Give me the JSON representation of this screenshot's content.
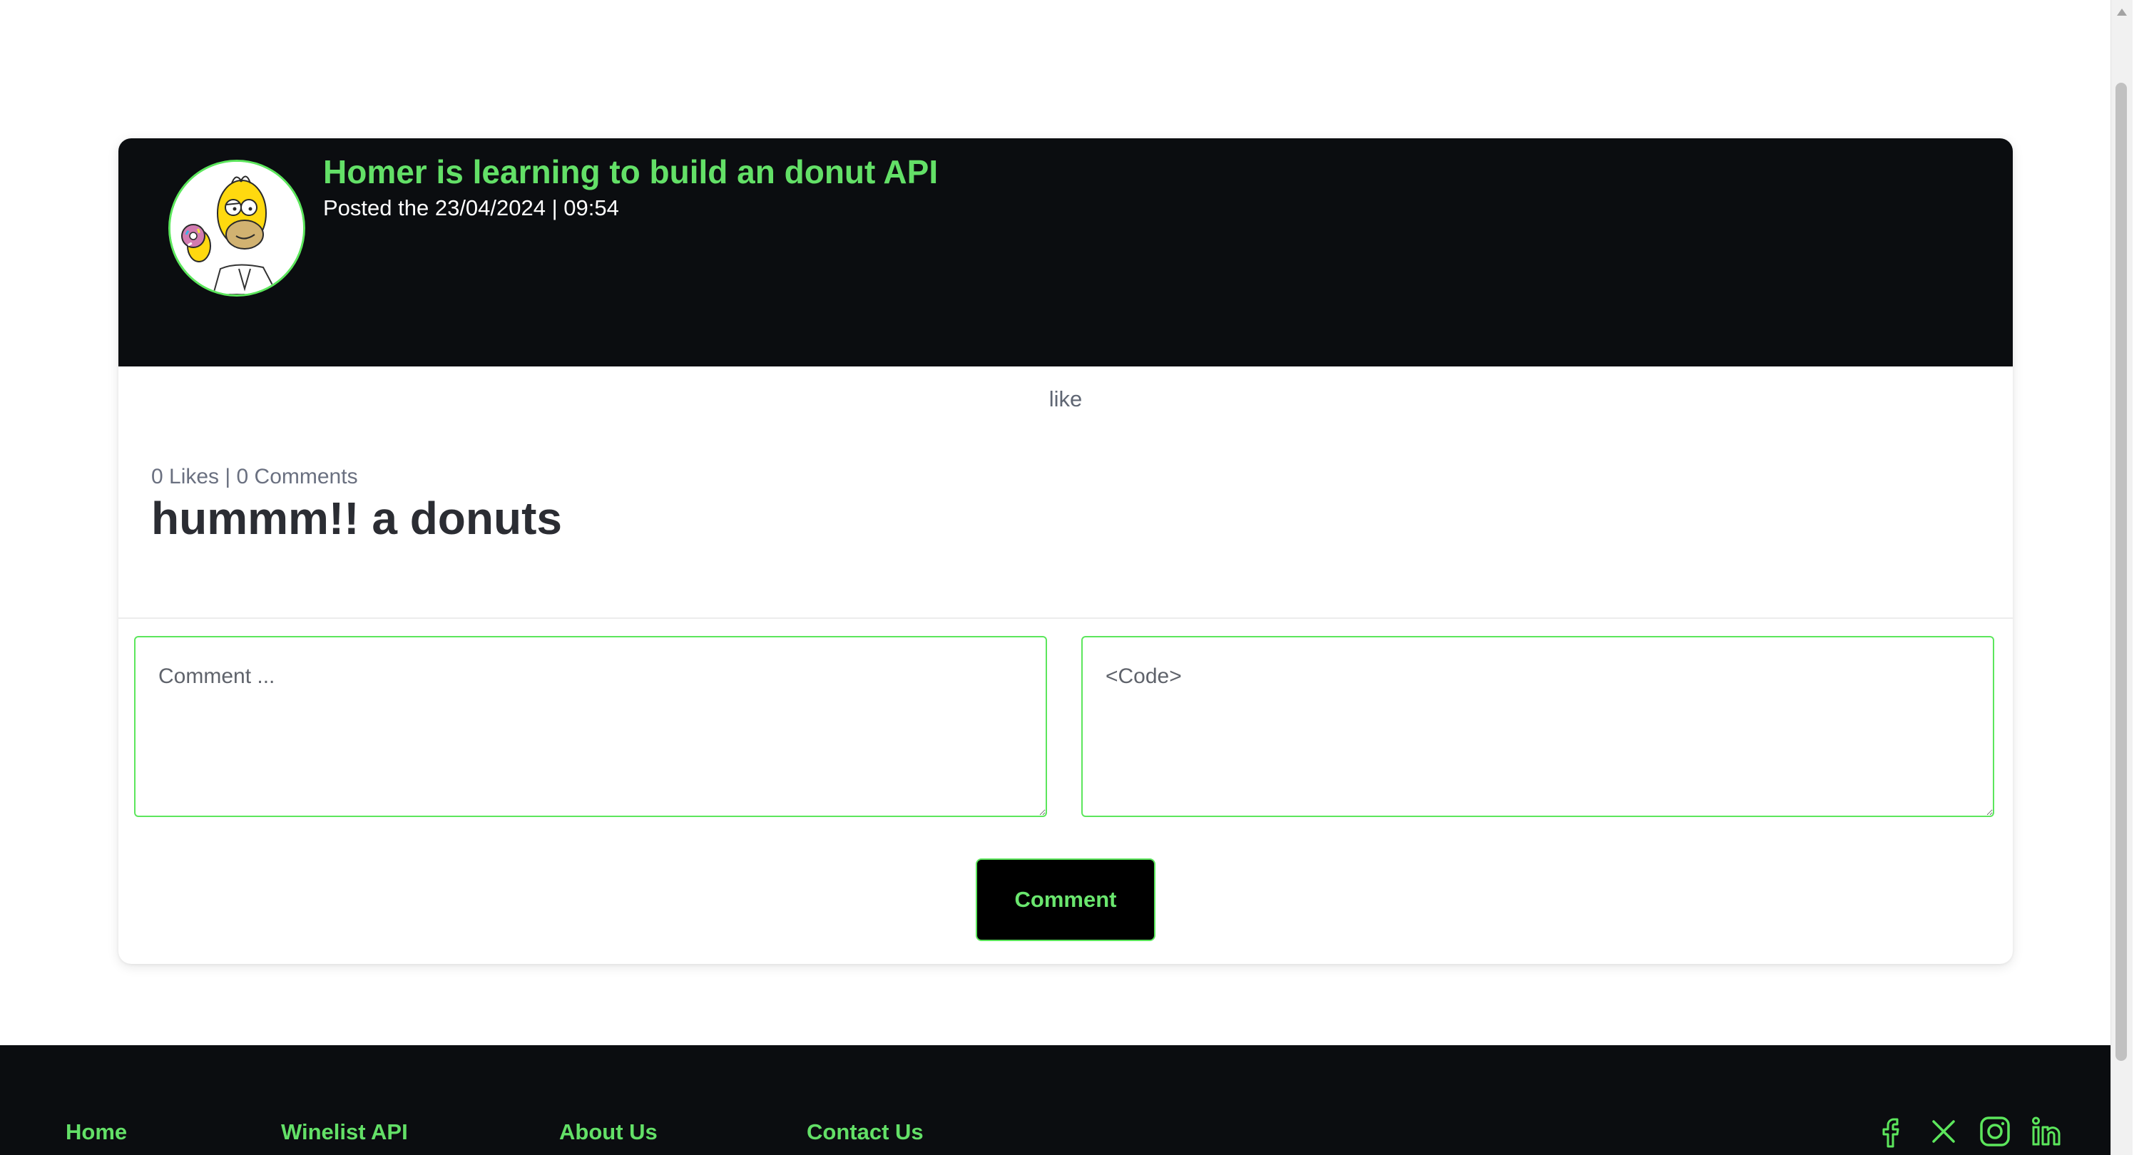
{
  "post": {
    "title": "Homer is learning to build an donut API",
    "posted": "Posted the 23/04/2024 | 09:54",
    "avatar_icon": "homer-avatar",
    "like_label": "like",
    "stats": "0 Likes | 0 Comments",
    "body": "hummm!! a donuts"
  },
  "comment_form": {
    "comment_placeholder": "Comment ...",
    "code_placeholder": "<Code>",
    "submit_label": "Comment"
  },
  "footer": {
    "links": [
      "Home",
      "Winelist API",
      "About Us",
      "Contact Us"
    ],
    "social_icons": [
      "facebook-icon",
      "x-icon",
      "instagram-icon",
      "linkedin-icon"
    ]
  },
  "colors": {
    "accent": "#5ce65c",
    "dark": "#0b0d10",
    "heading": "#2b2d33"
  }
}
